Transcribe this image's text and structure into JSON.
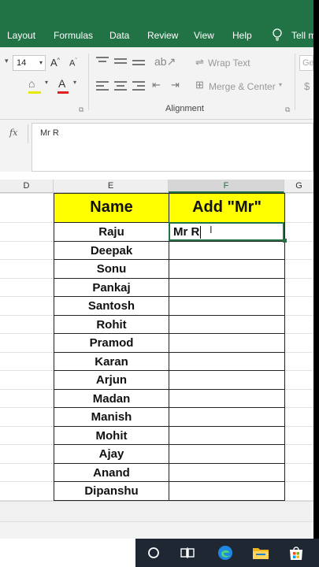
{
  "ribbon_tabs": [
    "Layout",
    "Formulas",
    "Data",
    "Review",
    "View",
    "Help"
  ],
  "tell_me": "Tell m",
  "font": {
    "size": "14"
  },
  "alignment": {
    "wrap_text": "Wrap Text",
    "merge_center": "Merge & Center",
    "group_label": "Alignment"
  },
  "number_group": {
    "general_hint": "Ge",
    "currency_hint": "$"
  },
  "formula_bar": {
    "fx": "fx",
    "value": "Mr R"
  },
  "columns": [
    "D",
    "E",
    "F",
    "G"
  ],
  "table": {
    "headers": [
      "Name",
      "Add \"Mr\""
    ],
    "names": [
      "Raju",
      "Deepak",
      "Sonu",
      "Pankaj",
      "Santosh",
      "Rohit",
      "Pramod",
      "Karan",
      "Arjun",
      "Madan",
      "Manish",
      "Mohit",
      "Ajay",
      "Anand",
      "Dipanshu"
    ],
    "editing_value": "Mr R"
  },
  "colors": {
    "excel_green": "#217346",
    "header_fill": "#ffff00",
    "taskbar": "#1f2733"
  },
  "taskbar_icons": [
    "search-circle-icon",
    "task-view-icon",
    "edge-browser-icon",
    "file-explorer-icon",
    "store-icon"
  ]
}
